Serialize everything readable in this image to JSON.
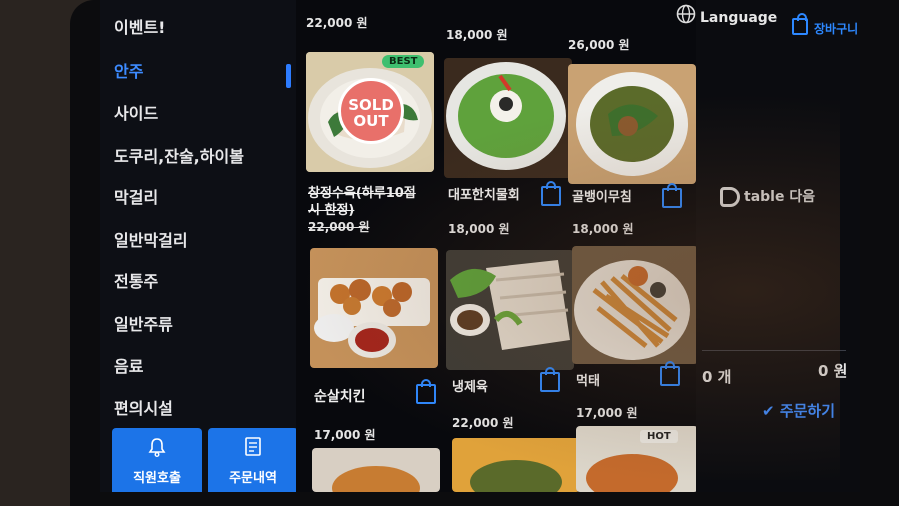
{
  "sidebar": {
    "categories": [
      "이벤트!",
      "안주",
      "사이드",
      "도쿠리,잔술,하이볼",
      "막걸리",
      "일반막걸리",
      "전통주",
      "일반주류",
      "음료",
      "편의시설"
    ],
    "active_index": 1,
    "staff_call_label": "직원호출",
    "order_history_label": "주문내역"
  },
  "header": {
    "language_label": "Language",
    "cart_label": "장바구니"
  },
  "top_prices": [
    "22,000 원",
    "18,000 원",
    "26,000 원"
  ],
  "menu": [
    {
      "name": "창정수육(하루10접시 한정)",
      "name_line1": "창정수육(하루10접",
      "name_line2": "시 한정)",
      "price": "22,000 원",
      "badge": "BEST",
      "sold_out": "SOLD OUT",
      "sold_out_line1": "SOLD",
      "sold_out_line2": "OUT"
    },
    {
      "name": "대포한치물회",
      "price": "18,000 원"
    },
    {
      "name": "골뱅이무침",
      "price": "18,000 원"
    },
    {
      "name": "순살치킨",
      "price": "17,000 원"
    },
    {
      "name": "냉제육",
      "price": "22,000 원"
    },
    {
      "name": "먹태",
      "price": "17,000 원"
    },
    {
      "badge": "HOT"
    }
  ],
  "summary": {
    "brand": "table 다음",
    "count": "0 개",
    "total": "0 원",
    "order_label": "주문하기"
  },
  "colors": {
    "accent": "#2d88ff",
    "best_badge": "#3fbf6f",
    "sold_out": "#e8706a",
    "background": "#08090d"
  },
  "icons": [
    "globe-icon",
    "shopping-bag-icon",
    "bell-icon",
    "receipt-icon",
    "check-icon"
  ]
}
